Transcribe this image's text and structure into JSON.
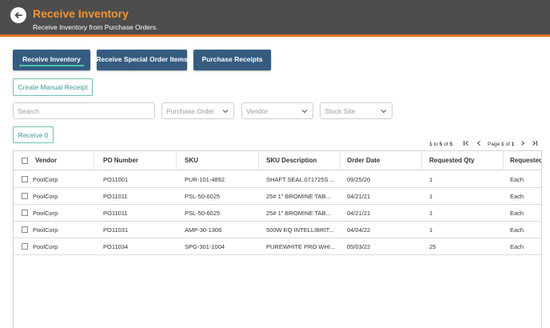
{
  "header": {
    "title": "Receive Inventory",
    "subtitle": "Receive Inventory from Purchase Orders."
  },
  "nav": {
    "receive_inventory": "Receive Inventory",
    "receive_special": "Receive Special Order Items",
    "purchase_receipts": "Purchase Receipts"
  },
  "actions": {
    "create_manual_receipt": "Create Manual Receipt",
    "receive": "Receive 0"
  },
  "filters": {
    "search_placeholder": "Search",
    "purchase_order": "Purchase Order",
    "vendor": "Vendor",
    "stock_site": "Stock Site"
  },
  "pager": {
    "range_start": "1",
    "range_to": "to",
    "range_end": "5",
    "range_of": "of",
    "range_total": "5",
    "page_label": "Page",
    "page_current": "1",
    "page_of": "of",
    "page_total": "1"
  },
  "table": {
    "columns": [
      "Vendor",
      "PO Number",
      "SKU",
      "SKU Description",
      "Order Date",
      "Requested Qty",
      "Requested"
    ],
    "rows": [
      {
        "vendor": "PoolCorp",
        "po": "PO11001",
        "sku": "PUR-101-4892",
        "desc": "SHAFT SEAL 071725S ...",
        "date": "09/25/20",
        "qty": "1",
        "uom": "Each"
      },
      {
        "vendor": "PoolCorp",
        "po": "PO11011",
        "sku": "PSL-50-6025",
        "desc": "25# 1\" BROMINE TAB...",
        "date": "04/21/21",
        "qty": "1",
        "uom": "Each"
      },
      {
        "vendor": "PoolCorp",
        "po": "PO11011",
        "sku": "PSL-50-6025",
        "desc": "25# 1\" BROMINE TAB...",
        "date": "04/21/21",
        "qty": "1",
        "uom": "Each"
      },
      {
        "vendor": "PoolCorp",
        "po": "PO11031",
        "sku": "AMP-30-1306",
        "desc": "500W EQ INTELLIBRIT...",
        "date": "04/04/22",
        "qty": "1",
        "uom": "Each"
      },
      {
        "vendor": "PoolCorp",
        "po": "PO11034",
        "sku": "SPG-301-1004",
        "desc": "PUREWHITE PRO WHI...",
        "date": "05/03/22",
        "qty": "25",
        "uom": "Each"
      }
    ]
  },
  "colors": {
    "header_bg": "#4d4d4d",
    "accent_orange": "#f39433",
    "nav_button": "#355c80",
    "teal": "#3a9c8f"
  }
}
